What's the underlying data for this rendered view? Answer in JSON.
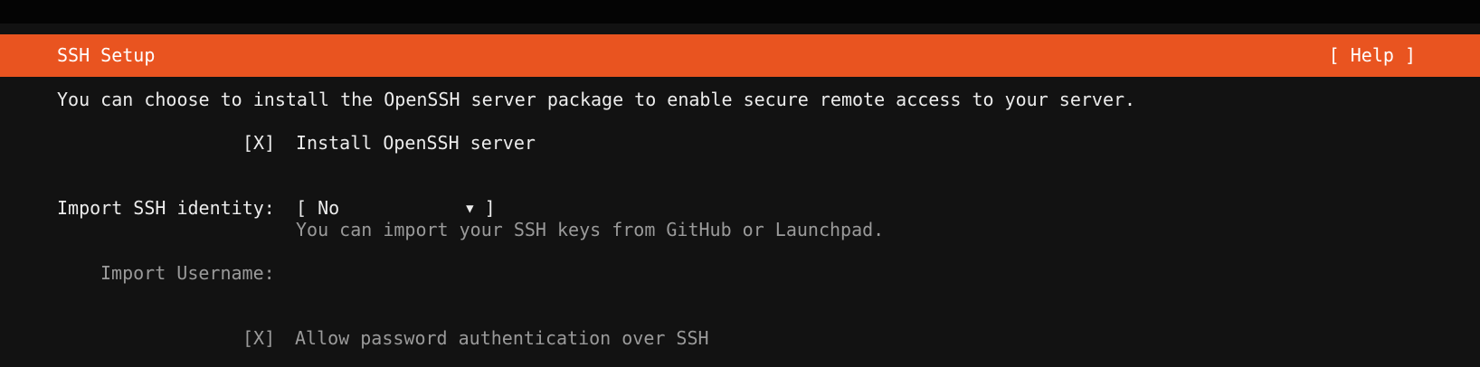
{
  "header": {
    "title": "SSH Setup",
    "help": "[ Help ]"
  },
  "description": "You can choose to install the OpenSSH server package to enable secure remote access to your server.",
  "install_openssh": {
    "checkbox": "[X]",
    "label": "Install OpenSSH server"
  },
  "import_identity": {
    "label": "Import SSH identity:",
    "dropdown_open": "[ ",
    "selected_value": "No",
    "arrow": "▼",
    "dropdown_close": " ]",
    "hint": "You can import your SSH keys from GitHub or Launchpad."
  },
  "import_username": {
    "label": "Import Username:"
  },
  "allow_password": {
    "checkbox": "[X]",
    "label": "Allow password authentication over SSH"
  },
  "colors": {
    "accent": "#e95420",
    "background": "#121212",
    "topbar": "#040404",
    "text": "#e8e8e8",
    "dim_text": "#9a9a9a"
  }
}
